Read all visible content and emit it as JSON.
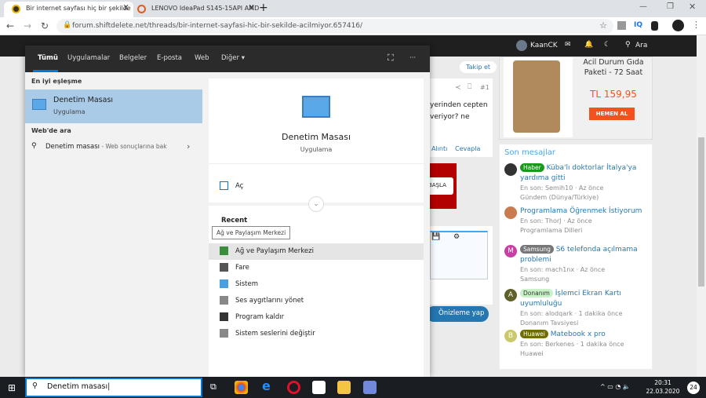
{
  "browser": {
    "tabs": [
      {
        "title": "Bir internet sayfası hiç bir şekilde",
        "close": "X"
      },
      {
        "title": "LENOVO IdeaPad S145-15API AMD",
        "close": "X"
      }
    ],
    "new_tab": "+",
    "url": "forum.shiftdelete.net/threads/bir-internet-sayfasi-hic-bir-sekilde-acilmiyor.657416/",
    "ext_iq": "IQ"
  },
  "site": {
    "user": "KaanCK",
    "search": "Ara",
    "follow": "Takip et",
    "post_no": "#1",
    "post_text_1": "yerinden cepten",
    "post_text_2": "veriyor? ne",
    "quote": "Alıntı",
    "reply": "Cevapla",
    "ad_btn": "BAŞLA",
    "preview": "Önizleme yap"
  },
  "ad": {
    "title": "Acil Durum Gıda Paketi - 72 Saat",
    "price": "TL 159,95",
    "buy": "HEMEN AL"
  },
  "recent": {
    "title": "Son mesajlar",
    "items": [
      {
        "badge": "Haber",
        "badge_color": "#1a9a1a",
        "title": "Küba'lı doktorlar İtalya'ya yardıma gitti",
        "meta": "En son: Semih10 · Az önce",
        "forum": "Gündem (Dünya/Türkiye)",
        "avatar": "",
        "avatar_color": "#333"
      },
      {
        "badge": "",
        "title": "Programlama Öğrenmek İstiyorum",
        "meta": "En son: ThorJ · Az önce",
        "forum": "Programlama Dilleri",
        "avatar": "",
        "avatar_color": "#c97b4f"
      },
      {
        "badge": "Samsung",
        "badge_color": "#777",
        "title": "S6 telefonda açılmama problemi",
        "meta": "En son: mach1nx · Az önce",
        "forum": "Samsung",
        "avatar": "M",
        "avatar_color": "#c93fa6"
      },
      {
        "badge": "Donanım",
        "badge_color": "#c9f2c9",
        "title": "İşlemci Ekran Kartı uyumluluğu",
        "meta": "En son: alodqark · 1 dakika önce",
        "forum": "Donanım Tavsiyesi",
        "avatar": "A",
        "avatar_color": "#5e6128"
      },
      {
        "badge": "Huawei",
        "badge_color": "#6e6e00",
        "title": "Matebook x pro",
        "meta": "En son: Berkenes · 1 dakika önce",
        "forum": "Huawei",
        "avatar": "B",
        "avatar_color": "#c9c96a"
      }
    ]
  },
  "start": {
    "tabs": [
      "Tümü",
      "Uygulamalar",
      "Belgeler",
      "E-posta",
      "Web",
      "Diğer ▾"
    ],
    "more": "···",
    "best_match_label": "En iyi eşleşme",
    "best_title": "Denetim Masası",
    "best_sub": "Uygulama",
    "web_label": "Web'de ara",
    "web_query": "Denetim masası",
    "web_suffix": " - Web sonuçlarına bak",
    "detail_title": "Denetim Masası",
    "detail_sub": "Uygulama",
    "open": "Aç",
    "recent": "Recent",
    "tooltip": "Ağ ve Paylaşım Merkezi",
    "recent_items": [
      "Ağ ve Paylaşım Merkezi",
      "Fare",
      "Sistem",
      "Ses aygıtlarını yönet",
      "Program kaldır",
      "Sistem seslerini değiştir"
    ]
  },
  "taskbar": {
    "search_value": "Denetim masası",
    "time": "20:31",
    "date": "22.03.2020",
    "notif_count": "24"
  }
}
